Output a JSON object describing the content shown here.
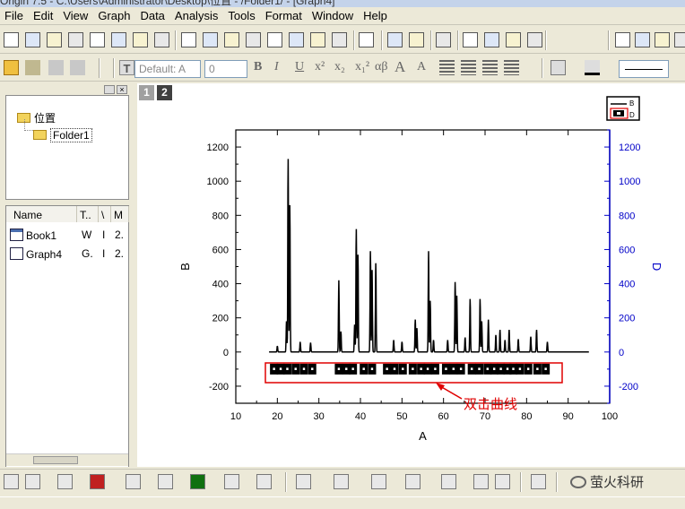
{
  "window": {
    "title": "Origin 7.5 - C:\\Users\\Administrator\\Desktop\\位置 - /Folder1/ - [Graph4]"
  },
  "menu": [
    "File",
    "Edit",
    "View",
    "Graph",
    "Data",
    "Analysis",
    "Tools",
    "Format",
    "Window",
    "Help"
  ],
  "format_bar": {
    "font_placeholder": "Default: A",
    "size_value": "0",
    "bold": "B",
    "italic": "I",
    "underline": "U",
    "superscript": "x²",
    "subscript": "x₂",
    "supsub": "x₁²",
    "greek": "αβ",
    "grow": "A",
    "shrink": "A"
  },
  "explorer": {
    "root": "位置",
    "folder": "Folder1",
    "columns": [
      "Name",
      "T..",
      "\\",
      "M"
    ],
    "rows": [
      {
        "name": "Book1",
        "type": "W",
        "v": "I",
        "m": "2."
      },
      {
        "name": "Graph4",
        "type": "G.",
        "v": "I",
        "m": "2."
      }
    ]
  },
  "graph": {
    "page_tabs": [
      "1",
      "2"
    ],
    "legend_items": [
      "B",
      "D"
    ],
    "annotation": "双击曲线",
    "watermark": "萤火科研",
    "colors": {
      "data_line": "#000000",
      "right_axis": "#0000c8",
      "annotation": "#e00000"
    }
  },
  "chart_data": {
    "type": "line",
    "xlabel": "A",
    "ylabel": "B",
    "ylabel_right": "D",
    "xlim": [
      10,
      100
    ],
    "ylim": [
      -300,
      1300
    ],
    "xticks": [
      10,
      20,
      30,
      40,
      50,
      60,
      70,
      80,
      90,
      100
    ],
    "yticks": [
      -200,
      0,
      200,
      400,
      600,
      800,
      1000,
      1200
    ],
    "right_ylim": [
      -300,
      1300
    ],
    "right_yticks": [
      -200,
      0,
      200,
      400,
      600,
      800,
      1000,
      1200
    ],
    "series": [
      {
        "name": "B",
        "peaks": [
          [
            20.0,
            35
          ],
          [
            22.2,
            180
          ],
          [
            22.6,
            1130
          ],
          [
            23.0,
            860
          ],
          [
            25.5,
            60
          ],
          [
            28.0,
            55
          ],
          [
            34.8,
            420
          ],
          [
            35.3,
            120
          ],
          [
            38.6,
            160
          ],
          [
            39.0,
            720
          ],
          [
            39.4,
            570
          ],
          [
            42.4,
            590
          ],
          [
            42.8,
            480
          ],
          [
            43.7,
            520
          ],
          [
            48.0,
            70
          ],
          [
            50.0,
            60
          ],
          [
            53.2,
            190
          ],
          [
            53.6,
            140
          ],
          [
            56.4,
            590
          ],
          [
            56.8,
            300
          ],
          [
            57.6,
            70
          ],
          [
            61.0,
            70
          ],
          [
            62.8,
            410
          ],
          [
            63.2,
            330
          ],
          [
            65.2,
            85
          ],
          [
            66.4,
            310
          ],
          [
            68.8,
            310
          ],
          [
            69.2,
            180
          ],
          [
            70.8,
            190
          ],
          [
            72.6,
            100
          ],
          [
            73.6,
            130
          ],
          [
            74.8,
            70
          ],
          [
            75.8,
            130
          ],
          [
            78.0,
            75
          ],
          [
            81.0,
            90
          ],
          [
            82.4,
            130
          ],
          [
            85.0,
            60
          ]
        ],
        "baseline": 0,
        "x_range": [
          18,
          95
        ]
      },
      {
        "name": "D",
        "markers_x": [
          19.2,
          20.8,
          22.4,
          24.4,
          26.4,
          28.4,
          34.8,
          36.6,
          38.2,
          40.8,
          42.8,
          46.4,
          48.2,
          50.2,
          52.6,
          54.6,
          56.2,
          58.0,
          60.6,
          62.4,
          64.2,
          66.8,
          68.6,
          70.6,
          72.2,
          73.8,
          75.4,
          76.8,
          78.4,
          80.4,
          82.6,
          84.6
        ],
        "y": -100
      }
    ]
  }
}
